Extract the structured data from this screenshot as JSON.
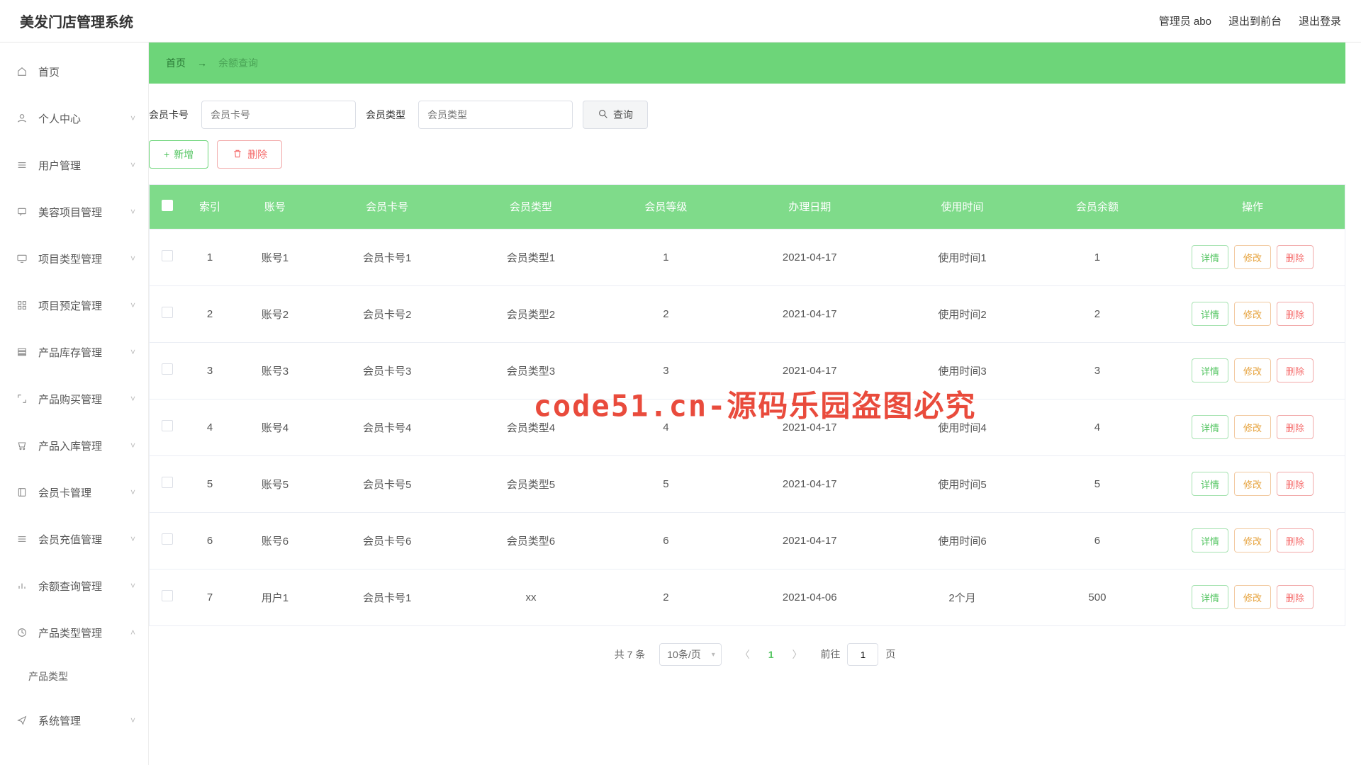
{
  "header": {
    "title": "美发门店管理系统",
    "admin_label": "管理员 abo",
    "front_label": "退出到前台",
    "logout_label": "退出登录"
  },
  "sidebar": {
    "items": [
      {
        "icon": "home",
        "label": "首页",
        "expandable": false
      },
      {
        "icon": "user",
        "label": "个人中心",
        "expandable": true
      },
      {
        "icon": "menu",
        "label": "用户管理",
        "expandable": true
      },
      {
        "icon": "chat",
        "label": "美容项目管理",
        "expandable": true
      },
      {
        "icon": "monitor",
        "label": "项目类型管理",
        "expandable": true
      },
      {
        "icon": "grid",
        "label": "项目预定管理",
        "expandable": true
      },
      {
        "icon": "stack",
        "label": "产品库存管理",
        "expandable": true
      },
      {
        "icon": "expand",
        "label": "产品购买管理",
        "expandable": true
      },
      {
        "icon": "cart",
        "label": "产品入库管理",
        "expandable": true
      },
      {
        "icon": "book",
        "label": "会员卡管理",
        "expandable": true
      },
      {
        "icon": "menu",
        "label": "会员充值管理",
        "expandable": true
      },
      {
        "icon": "chart",
        "label": "余额查询管理",
        "expandable": true
      },
      {
        "icon": "circle",
        "label": "产品类型管理",
        "expandable": true,
        "expanded": true,
        "sub": "产品类型"
      },
      {
        "icon": "send",
        "label": "系统管理",
        "expandable": true
      }
    ]
  },
  "breadcrumb": {
    "home": "首页",
    "current": "余额查询"
  },
  "filters": {
    "card_label": "会员卡号",
    "card_placeholder": "会员卡号",
    "type_label": "会员类型",
    "type_placeholder": "会员类型",
    "search_label": "查询"
  },
  "actions": {
    "add_label": "新增",
    "delete_label": "删除"
  },
  "table": {
    "headers": [
      "索引",
      "账号",
      "会员卡号",
      "会员类型",
      "会员等级",
      "办理日期",
      "使用时间",
      "会员余额",
      "操作"
    ],
    "rows": [
      {
        "idx": "1",
        "acct": "账号1",
        "card": "会员卡号1",
        "type": "会员类型1",
        "level": "1",
        "date": "2021-04-17",
        "time": "使用时间1",
        "bal": "1"
      },
      {
        "idx": "2",
        "acct": "账号2",
        "card": "会员卡号2",
        "type": "会员类型2",
        "level": "2",
        "date": "2021-04-17",
        "time": "使用时间2",
        "bal": "2"
      },
      {
        "idx": "3",
        "acct": "账号3",
        "card": "会员卡号3",
        "type": "会员类型3",
        "level": "3",
        "date": "2021-04-17",
        "time": "使用时间3",
        "bal": "3"
      },
      {
        "idx": "4",
        "acct": "账号4",
        "card": "会员卡号4",
        "type": "会员类型4",
        "level": "4",
        "date": "2021-04-17",
        "time": "使用时间4",
        "bal": "4"
      },
      {
        "idx": "5",
        "acct": "账号5",
        "card": "会员卡号5",
        "type": "会员类型5",
        "level": "5",
        "date": "2021-04-17",
        "time": "使用时间5",
        "bal": "5"
      },
      {
        "idx": "6",
        "acct": "账号6",
        "card": "会员卡号6",
        "type": "会员类型6",
        "level": "6",
        "date": "2021-04-17",
        "time": "使用时间6",
        "bal": "6"
      },
      {
        "idx": "7",
        "acct": "用户1",
        "card": "会员卡号1",
        "type": "xx",
        "level": "2",
        "date": "2021-04-06",
        "time": "2个月",
        "bal": "500"
      }
    ],
    "row_actions": {
      "detail": "详情",
      "edit": "修改",
      "del": "删除"
    }
  },
  "pagination": {
    "total": "共 7 条",
    "page_size": "10条/页",
    "current": "1",
    "goto_prefix": "前往",
    "goto_value": "1",
    "goto_suffix": "页"
  },
  "watermark": "code51.cn-源码乐园盗图必究"
}
